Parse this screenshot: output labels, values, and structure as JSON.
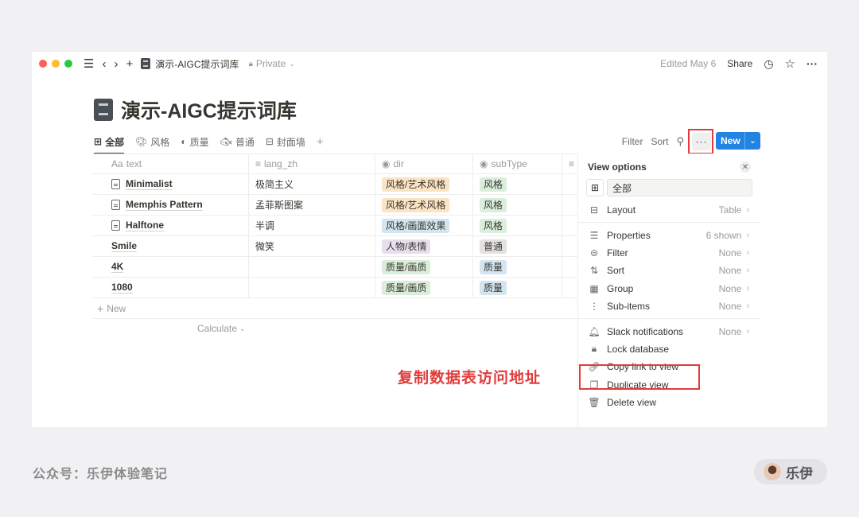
{
  "topbar": {
    "title": "演示-AIGC提示词库",
    "privacy": "Private",
    "edited": "Edited May 6",
    "share_label": "Share",
    "dot_colors": [
      "#fe5f57",
      "#febc2e",
      "#28c840"
    ]
  },
  "page": {
    "title": "演示-AIGC提示词库"
  },
  "tabs": [
    {
      "label": "全部",
      "icon": "table-icon",
      "active": true
    },
    {
      "label": "风格",
      "icon": "palette-icon"
    },
    {
      "label": "质量",
      "icon": "contrast-icon"
    },
    {
      "label": "普通",
      "icon": "fish-icon"
    },
    {
      "label": "封面墙",
      "icon": "gallery-icon"
    }
  ],
  "toolbar": {
    "filter": "Filter",
    "sort": "Sort",
    "new": "New",
    "accent": "#2383e2"
  },
  "table": {
    "columns": [
      {
        "label": "text",
        "icon": "Aa"
      },
      {
        "label": "lang_zh",
        "icon": "≡"
      },
      {
        "label": "dir",
        "icon": "◉"
      },
      {
        "label": "subType",
        "icon": "◉"
      }
    ],
    "rows": [
      {
        "text": "Minimalist",
        "page": true,
        "lang_zh": "极简主义",
        "dir": "风格/艺术风格",
        "subType": "风格"
      },
      {
        "text": "Memphis Pattern",
        "page": true,
        "lang_zh": "孟菲斯图案",
        "dir": "风格/艺术风格",
        "subType": "风格"
      },
      {
        "text": "Halftone",
        "page": true,
        "lang_zh": "半调",
        "dir": "风格/画面效果",
        "subType": "风格"
      },
      {
        "text": "Smile",
        "page": false,
        "lang_zh": "微笑",
        "dir": "人物/表情",
        "subType": "普通"
      },
      {
        "text": "4K",
        "page": false,
        "lang_zh": "",
        "dir": "质量/画质",
        "subType": "质量"
      },
      {
        "text": "1080",
        "page": false,
        "lang_zh": "",
        "dir": "质量/画质",
        "subType": "质量"
      }
    ],
    "new_row": "New",
    "calculate": "Calculate"
  },
  "tag_colors": {
    "风格/艺术风格": "#fbe4c4",
    "风格/画面效果": "#d3e5ef",
    "人物/表情": "#e8deee",
    "质量/画质": "#dbeddb",
    "风格": "#dbeddb",
    "普通": "#e3e2e0",
    "质量": "#d3e5ef"
  },
  "panel": {
    "title": "View options",
    "view_name": "全部",
    "layout": {
      "label": "Layout",
      "value": "Table"
    },
    "group1": [
      {
        "label": "Properties",
        "value": "6 shown",
        "icon": "☰"
      },
      {
        "label": "Filter",
        "value": "None",
        "icon": "⊜"
      },
      {
        "label": "Sort",
        "value": "None",
        "icon": "⇅"
      },
      {
        "label": "Group",
        "value": "None",
        "icon": "▦"
      },
      {
        "label": "Sub-items",
        "value": "None",
        "icon": "⋮"
      }
    ],
    "group2": [
      {
        "label": "Slack notifications",
        "value": "None",
        "icon": "🔔︎"
      },
      {
        "label": "Lock database",
        "value": "",
        "icon": "🔒︎"
      },
      {
        "label": "Copy link to view",
        "value": "",
        "icon": "🔗︎"
      },
      {
        "label": "Duplicate view",
        "value": "",
        "icon": "❐"
      },
      {
        "label": "Delete view",
        "value": "",
        "icon": "🗑︎"
      }
    ]
  },
  "annotation": "复制数据表访问地址",
  "footer": {
    "left": "公众号：乐伊体验笔记",
    "badge": "乐伊"
  }
}
